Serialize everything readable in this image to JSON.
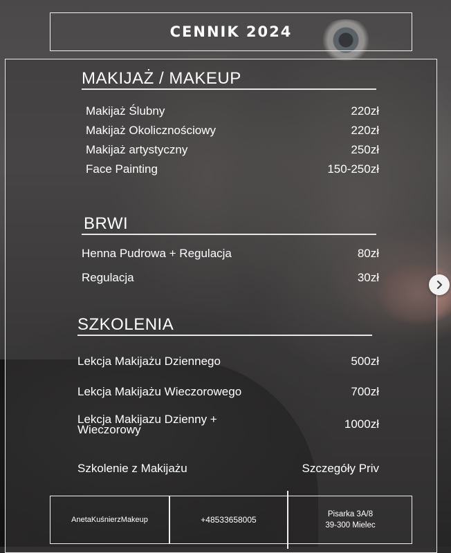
{
  "title": "CENNIK 2024",
  "sections": {
    "makeup": {
      "title": "MAKIJAŻ / MAKEUP",
      "items": [
        {
          "label": "Makijaż Ślubny",
          "price": "220zł"
        },
        {
          "label": "Makijaż Okolicznościowy",
          "price": "220zł"
        },
        {
          "label": "Makijaż artystyczny",
          "price": "250zł"
        },
        {
          "label": "Face Painting",
          "price": "150-250zł"
        }
      ]
    },
    "brwi": {
      "title": "BRWI",
      "items": [
        {
          "label": "Henna Pudrowa + Regulacja",
          "price": "80zł"
        },
        {
          "label": "Regulacja",
          "price": "30zł"
        }
      ]
    },
    "szkolenia": {
      "title": "SZKOLENIA",
      "items": [
        {
          "label": "Lekcja Makijażu Dziennego",
          "price": "500zł"
        },
        {
          "label": "Lekcja Makijażu Wieczorowego",
          "price": "700zł"
        },
        {
          "label_line1": "Lekcja Makijazu Dzienny +",
          "label_line2": "Wieczorowy",
          "price": "1000zł"
        },
        {
          "label": "Szkolenie z Makijażu",
          "price": "Szczegóły Priv"
        }
      ]
    }
  },
  "footer": {
    "name": "AnetaKuśnierzMakeup",
    "phone": "+48533658005",
    "address_line1": "Pisarka 3A/8",
    "address_line2": "39-300 Mielec"
  },
  "next_arrow_icon": "chevron-right-icon"
}
